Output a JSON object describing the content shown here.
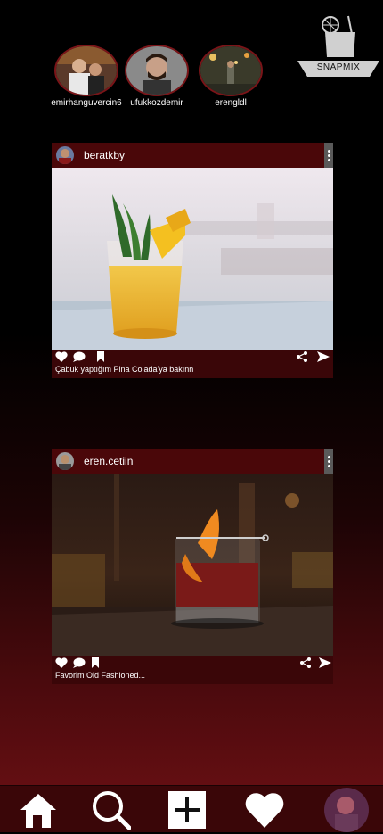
{
  "stories": [
    {
      "username": "emirhanguvercin6"
    },
    {
      "username": "ufukkozdemir"
    },
    {
      "username": "erengldl"
    }
  ],
  "logo": {
    "text": "SNAPMIX",
    "icon": "cocktail-glass-icon"
  },
  "posts": [
    {
      "username": "beratkby",
      "caption": "Çabuk yaptığım Pina Colada'ya bakınn",
      "image": "pina-colada-photo"
    },
    {
      "username": "eren.cetiin",
      "caption": "Favorim Old Fashioned...",
      "image": "old-fashioned-photo"
    }
  ],
  "nav": {
    "items": [
      "home-icon",
      "search-icon",
      "add-icon",
      "heart-icon",
      "profile-avatar"
    ]
  },
  "colors": {
    "post_bg": "#3a0608",
    "header_bg": "#4a0709",
    "accent": "#7a1418"
  }
}
